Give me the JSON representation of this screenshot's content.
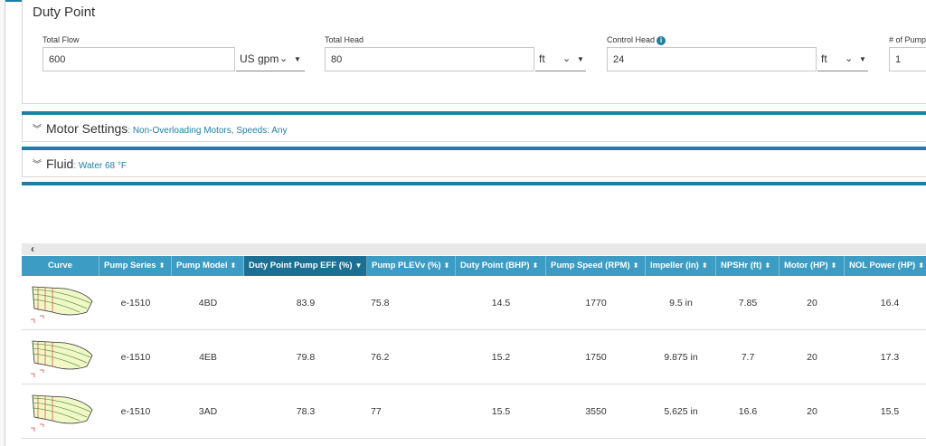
{
  "duty_point": {
    "title": "Duty Point",
    "total_flow": {
      "label": "Total Flow",
      "value": "600",
      "unit": "US gpm"
    },
    "total_head": {
      "label": "Total Head",
      "value": "80",
      "unit": "ft"
    },
    "control_head": {
      "label": "Control Head",
      "value": "24",
      "unit": "ft"
    },
    "num_pumps": {
      "label": "# of Pump",
      "value": "1"
    }
  },
  "motor_settings": {
    "title": "Motor Settings",
    "summary": ": Non-Overloading Motors, Speeds: Any"
  },
  "fluid": {
    "title": "Fluid",
    "summary": ": Water 68 °F"
  },
  "table": {
    "columns": [
      {
        "label": "Curve"
      },
      {
        "label": "Pump Series"
      },
      {
        "label": "Pump Model"
      },
      {
        "label": "Duty Point Pump EFF (%)"
      },
      {
        "label": "Pump PLEVv (%)"
      },
      {
        "label": "Duty Point (BHP)"
      },
      {
        "label": "Pump Speed (RPM)"
      },
      {
        "label": "Impeller (in)"
      },
      {
        "label": "NPSHr (ft)"
      },
      {
        "label": "Motor (HP)"
      },
      {
        "label": "NOL Power (HP)"
      }
    ],
    "rows": [
      {
        "series": "e-1510",
        "model": "4BD",
        "eff": "83.9",
        "plev": "75.8",
        "bhp": "14.5",
        "rpm": "1770",
        "impeller": "9.5 in",
        "npshr": "7.85",
        "motor": "20",
        "nol": "16.4"
      },
      {
        "series": "e-1510",
        "model": "4EB",
        "eff": "79.8",
        "plev": "76.2",
        "bhp": "15.2",
        "rpm": "1750",
        "impeller": "9.875 in",
        "npshr": "7.7",
        "motor": "20",
        "nol": "17.3"
      },
      {
        "series": "e-1510",
        "model": "3AD",
        "eff": "78.3",
        "plev": "77",
        "bhp": "15.5",
        "rpm": "3550",
        "impeller": "5.625 in",
        "npshr": "16.6",
        "motor": "20",
        "nol": "15.5"
      }
    ]
  },
  "icons": {
    "collapse": "double-chevron-down-icon",
    "info": "info-icon",
    "sort": "sort-icon",
    "scroll_left": "chevron-left-icon"
  },
  "colors": {
    "accent": "#1d7fa3",
    "header_bg": "#3d9cc4",
    "header_active": "#1b6f93"
  }
}
